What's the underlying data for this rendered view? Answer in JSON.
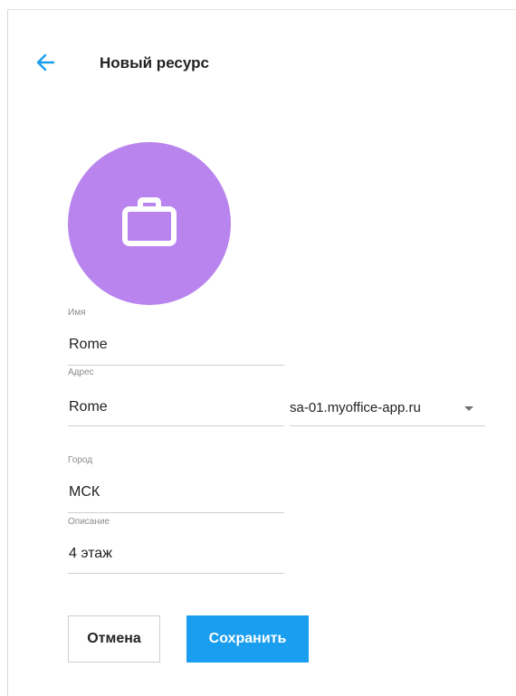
{
  "header": {
    "title": "Новый ресурс",
    "back_icon": "arrow-left-icon"
  },
  "avatar": {
    "icon": "briefcase-icon",
    "color": "#b984ee"
  },
  "form": {
    "name": {
      "label": "Имя",
      "value": "Rome"
    },
    "address": {
      "label": "Адрес",
      "value": "Rome",
      "domain": "sa-01.myoffice-app.ru"
    },
    "city": {
      "label": "Город",
      "value": "МСК"
    },
    "description": {
      "label": "Описание",
      "value": "4 этаж"
    }
  },
  "actions": {
    "cancel_label": "Отмена",
    "save_label": "Сохранить"
  },
  "colors": {
    "accent": "#1a9ef0",
    "avatar": "#b984ee"
  }
}
